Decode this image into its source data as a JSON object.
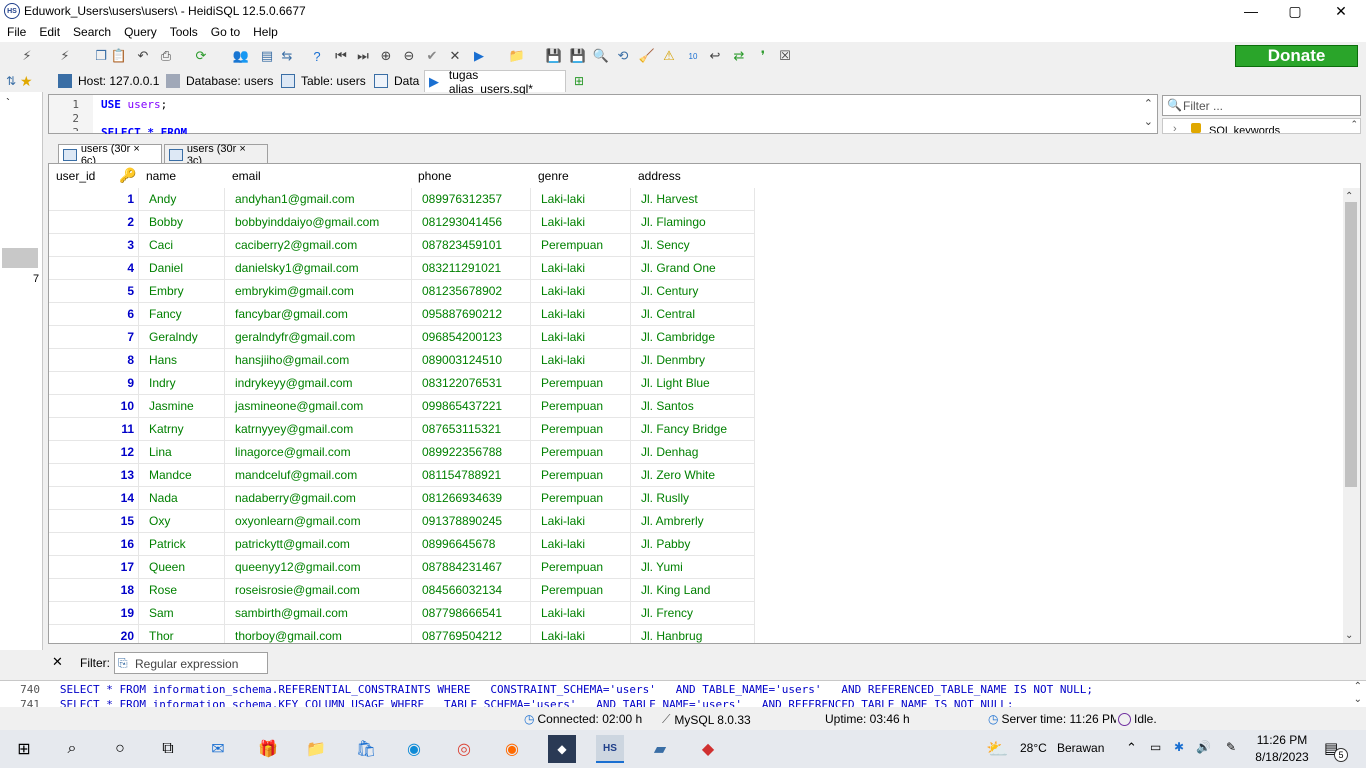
{
  "window": {
    "title": "Eduwork_Users\\users\\users\\ - HeidiSQL 12.5.0.6677",
    "app_icon_text": "HS",
    "minimize": "—",
    "maximize": "▢",
    "close": "✕"
  },
  "menu": [
    "File",
    "Edit",
    "Search",
    "Query",
    "Tools",
    "Go to",
    "Help"
  ],
  "toolbar": {
    "donate_label": "Donate"
  },
  "tabs": [
    {
      "label": "Host: 127.0.0.1",
      "icon": "host-icon"
    },
    {
      "label": "Database: users",
      "icon": "database-icon"
    },
    {
      "label": "Table: users",
      "icon": "table-icon"
    },
    {
      "label": "Data",
      "icon": "data-icon"
    },
    {
      "label": "tugas alias_users.sql*",
      "icon": "query-icon",
      "active": true
    }
  ],
  "lefttree": {
    "marker": "`",
    "count": "7"
  },
  "editor": {
    "line1": "1",
    "line2": "2",
    "line3": "3",
    "code_kw": "USE",
    "code_db": "users",
    "code_semi": ";",
    "code_line3": "SELECT * FROM"
  },
  "side": {
    "filter_placeholder": "Filter ...",
    "sql_keywords": "SQL keywords"
  },
  "result_tabs": [
    "users (30r × 6c)",
    "users (30r × 3c)"
  ],
  "grid": {
    "columns": [
      "user_id",
      "name",
      "email",
      "phone",
      "genre",
      "address"
    ],
    "rows": [
      [
        "1",
        "Andy",
        "andyhan1@gmail.com",
        "089976312357",
        "Laki-laki",
        "Jl. Harvest"
      ],
      [
        "2",
        "Bobby",
        "bobbyinddaiyo@gmail.com",
        "081293041456",
        "Laki-laki",
        "Jl. Flamingo"
      ],
      [
        "3",
        "Caci",
        "caciberry2@gmail.com",
        "087823459101",
        "Perempuan",
        "Jl. Sency"
      ],
      [
        "4",
        "Daniel",
        "danielsky1@gmail.com",
        "083211291021",
        "Laki-laki",
        "Jl. Grand One"
      ],
      [
        "5",
        "Embry",
        "embrykim@gmail.com",
        "081235678902",
        "Laki-laki",
        "Jl. Century"
      ],
      [
        "6",
        "Fancy",
        "fancybar@gmail.com",
        "095887690212",
        "Laki-laki",
        "Jl. Central"
      ],
      [
        "7",
        "Geralndy",
        "geralndyfr@gmail.com",
        "096854200123",
        "Laki-laki",
        "Jl. Cambridge"
      ],
      [
        "8",
        "Hans",
        "hansjiiho@gmail.com",
        "089003124510",
        "Laki-laki",
        "Jl. Denmbry"
      ],
      [
        "9",
        "Indry",
        "indrykeyy@gmail.com",
        "083122076531",
        "Perempuan",
        "Jl. Light Blue"
      ],
      [
        "10",
        "Jasmine",
        "jasmineone@gmail.com",
        "099865437221",
        "Perempuan",
        "Jl. Santos"
      ],
      [
        "11",
        "Katrny",
        "katrnyyey@gmail.com",
        "087653115321",
        "Perempuan",
        "Jl. Fancy Bridge"
      ],
      [
        "12",
        "Lina",
        "linagorce@gmail.com",
        "089922356788",
        "Perempuan",
        "Jl. Denhag"
      ],
      [
        "13",
        "Mandce",
        "mandceluf@gmail.com",
        "081154788921",
        "Perempuan",
        "Jl. Zero White"
      ],
      [
        "14",
        "Nada",
        "nadaberry@gmail.com",
        "081266934639",
        "Perempuan",
        "Jl. Ruslly"
      ],
      [
        "15",
        "Oxy",
        "oxyonlearn@gmail.com",
        "091378890245",
        "Laki-laki",
        "Jl. Ambrerly"
      ],
      [
        "16",
        "Patrick",
        "patrickytt@gmail.com",
        "08996645678",
        "Laki-laki",
        "Jl. Pabby"
      ],
      [
        "17",
        "Queen",
        "queenyy12@gmail.com",
        "087884231467",
        "Perempuan",
        "Jl. Yumi"
      ],
      [
        "18",
        "Rose",
        "roseisrosie@gmail.com",
        "084566032134",
        "Perempuan",
        "Jl. King Land"
      ],
      [
        "19",
        "Sam",
        "sambirth@gmail.com",
        "087798666541",
        "Laki-laki",
        "Jl. Frency"
      ],
      [
        "20",
        "Thor",
        "thorboy@gmail.com",
        "087769504212",
        "Laki-laki",
        "Jl. Hanbrug"
      ]
    ]
  },
  "filterbar": {
    "close": "✕",
    "label": "Filter:",
    "placeholder": "Regular expression"
  },
  "log": {
    "line1_no": "740",
    "line1": "SELECT * FROM information_schema.REFERENTIAL_CONSTRAINTS WHERE   CONSTRAINT_SCHEMA='users'   AND TABLE_NAME='users'   AND REFERENCED_TABLE_NAME IS NOT NULL;",
    "line2_no": "741",
    "line2": "SELECT * FROM information_schema.KEY_COLUMN_USAGE WHERE   TABLE_SCHEMA='users'   AND TABLE_NAME='users'   AND REFERENCED_TABLE_NAME IS NOT NULL;"
  },
  "status": {
    "connected": "Connected: 02:00 h",
    "server": "MySQL 8.0.33",
    "uptime": "Uptime: 03:46 h",
    "server_time": "Server time: 11:26 PM",
    "state": "Idle."
  },
  "taskbar": {
    "weather_temp": "28°C",
    "weather_desc": "Berawan",
    "time": "11:26 PM",
    "date": "8/18/2023",
    "notifications": "5"
  }
}
